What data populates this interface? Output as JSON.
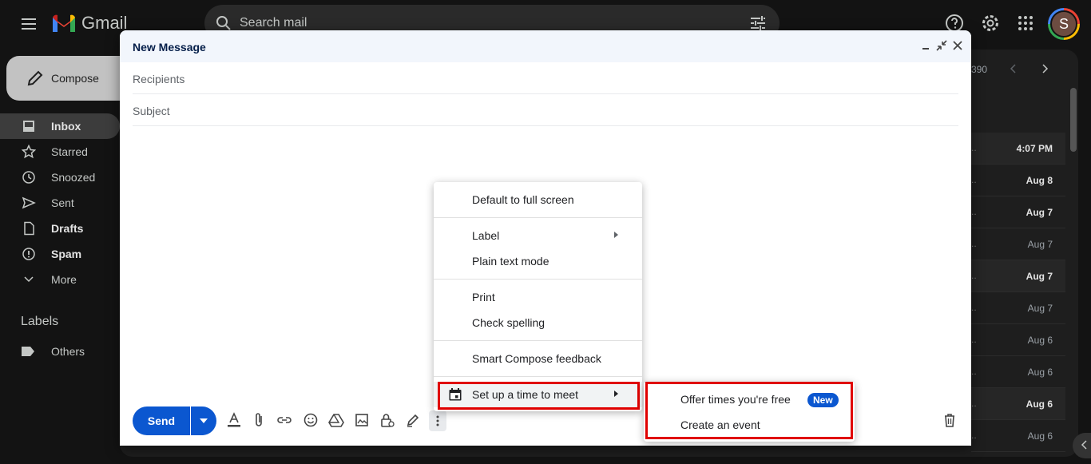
{
  "app": {
    "name": "Gmail",
    "avatar_initial": "S"
  },
  "search": {
    "placeholder": "Search mail"
  },
  "sidebar": {
    "compose_label": "Compose",
    "items": [
      {
        "label": "Inbox",
        "icon": "inbox-icon"
      },
      {
        "label": "Starred",
        "icon": "star-icon"
      },
      {
        "label": "Snoozed",
        "icon": "clock-icon"
      },
      {
        "label": "Sent",
        "icon": "send-icon"
      },
      {
        "label": "Drafts",
        "icon": "draft-icon"
      },
      {
        "label": "Spam",
        "icon": "spam-icon"
      },
      {
        "label": "More",
        "icon": "chevron-down-icon"
      }
    ],
    "labels_title": "Labels",
    "labels": [
      {
        "label": "Others",
        "icon": "label-icon"
      }
    ]
  },
  "mail_list": {
    "page_count": "390",
    "dates": [
      "4:07 PM",
      "Aug 8",
      "Aug 7",
      "Aug 7",
      "Aug 7",
      "Aug 7",
      "Aug 6",
      "Aug 6",
      "Aug 6",
      "Aug 6"
    ]
  },
  "compose": {
    "title": "New Message",
    "recipients_placeholder": "Recipients",
    "subject_placeholder": "Subject",
    "send_label": "Send"
  },
  "menu": {
    "items": [
      "Default to full screen",
      "Label",
      "Plain text mode",
      "Print",
      "Check spelling",
      "Smart Compose feedback",
      "Set up a time to meet"
    ]
  },
  "submenu": {
    "offer_times": "Offer times you're free",
    "new_badge": "New",
    "create_event": "Create an event"
  },
  "colors": {
    "accent": "#0b57d0",
    "highlight_box": "#e00000",
    "background": "#131313"
  }
}
